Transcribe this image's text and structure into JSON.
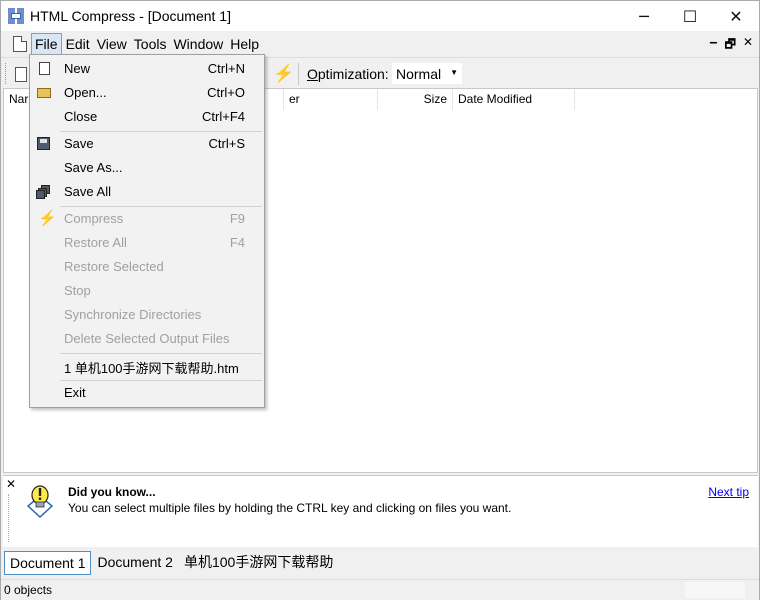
{
  "window": {
    "title": "HTML Compress - [Document 1]",
    "controls": {
      "minimize": "─",
      "maximize": "☐",
      "close": "✕"
    }
  },
  "menubar": {
    "items": [
      "File",
      "Edit",
      "View",
      "Tools",
      "Window",
      "Help"
    ],
    "active": "File",
    "mdi_controls": {
      "minimize": "‒",
      "restore": "🗗",
      "close": "✕"
    }
  },
  "toolbar": {
    "optimization_label_underlined": "O",
    "optimization_label_rest": "ptimization:",
    "optimization_value": "Normal"
  },
  "file_list": {
    "columns": [
      "Nar",
      "er",
      "Size",
      "Date Modified"
    ]
  },
  "file_menu": {
    "items": [
      {
        "label": "New",
        "shortcut": "Ctrl+N",
        "icon": "new-file-icon",
        "enabled": true
      },
      {
        "label": "Open...",
        "shortcut": "Ctrl+O",
        "icon": "open-folder-icon",
        "enabled": true
      },
      {
        "label": "Close",
        "shortcut": "Ctrl+F4",
        "icon": "",
        "enabled": true
      },
      {
        "label": "Save",
        "shortcut": "Ctrl+S",
        "icon": "save-disk-icon",
        "enabled": true
      },
      {
        "label": "Save As...",
        "shortcut": "",
        "icon": "",
        "enabled": true
      },
      {
        "label": "Save All",
        "shortcut": "",
        "icon": "save-all-icon",
        "enabled": true
      },
      {
        "label": "Compress",
        "shortcut": "F9",
        "icon": "lightning-icon",
        "enabled": false
      },
      {
        "label": "Restore All",
        "shortcut": "F4",
        "icon": "",
        "enabled": false
      },
      {
        "label": "Restore Selected",
        "shortcut": "",
        "icon": "",
        "enabled": false
      },
      {
        "label": "Stop",
        "shortcut": "",
        "icon": "",
        "enabled": false
      },
      {
        "label": "Synchronize Directories",
        "shortcut": "",
        "icon": "",
        "enabled": false
      },
      {
        "label": "Delete Selected Output Files",
        "shortcut": "",
        "icon": "",
        "enabled": false
      },
      {
        "label": "1 单机100手游网下载帮助.htm",
        "shortcut": "",
        "icon": "",
        "enabled": true
      },
      {
        "label": "Exit",
        "shortcut": "",
        "icon": "",
        "enabled": true
      }
    ]
  },
  "tip": {
    "title": "Did you know...",
    "text": "You can select multiple files by holding the CTRL key and clicking on files you want.",
    "next_link": "Next tip",
    "close": "✕"
  },
  "doc_tabs": {
    "tabs": [
      "Document 1",
      "Document 2",
      "单机100手游网下载帮助"
    ],
    "active": "Document 1"
  },
  "status": {
    "text": "0 objects"
  }
}
